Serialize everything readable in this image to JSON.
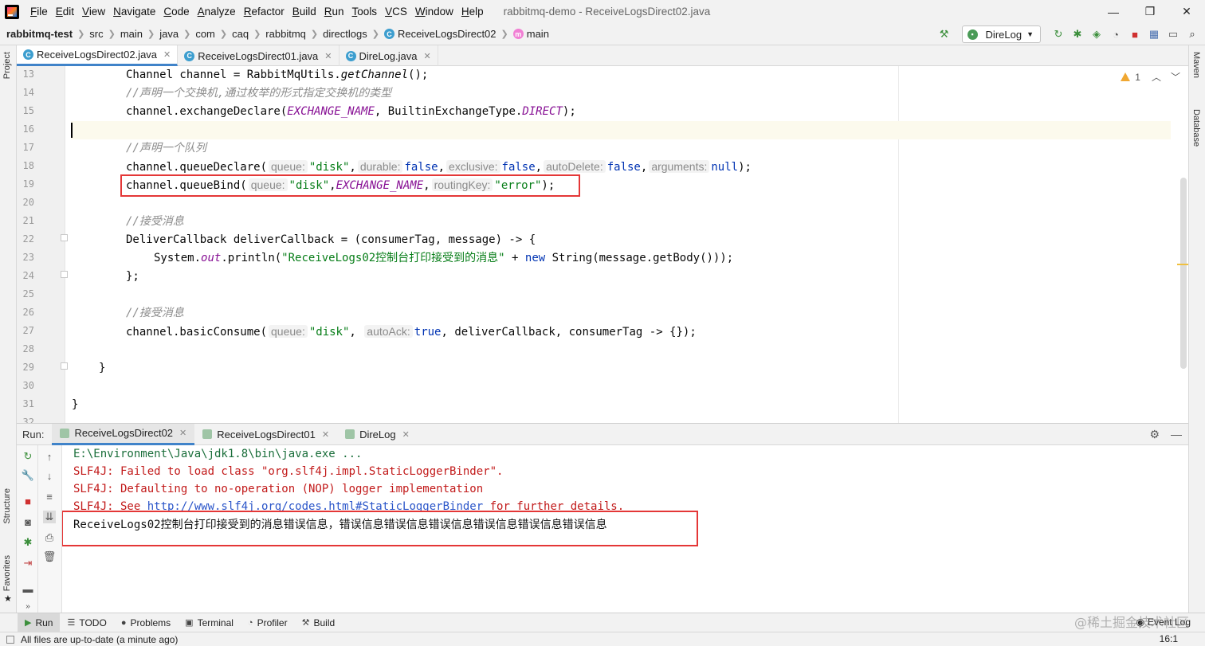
{
  "menubar": {
    "items": [
      "File",
      "Edit",
      "View",
      "Navigate",
      "Code",
      "Analyze",
      "Refactor",
      "Build",
      "Run",
      "Tools",
      "VCS",
      "Window",
      "Help"
    ],
    "window_title": "rabbitmq-demo - ReceiveLogsDirect02.java",
    "controls": [
      "minimize-icon",
      "restore-icon",
      "close-icon"
    ]
  },
  "breadcrumb": {
    "items": [
      "rabbitmq-test",
      "src",
      "main",
      "java",
      "com",
      "caq",
      "rabbitmq",
      "directlogs",
      "ReceiveLogsDirect02",
      "main"
    ],
    "run_config": "DireLog"
  },
  "left_strip": {
    "labels": [
      "Project",
      "Structure",
      "Favorites"
    ]
  },
  "right_strip": {
    "labels": [
      "Maven",
      "Database"
    ]
  },
  "editor_tabs": [
    {
      "label": "ReceiveLogsDirect02.java",
      "active": true
    },
    {
      "label": "ReceiveLogsDirect01.java",
      "active": false
    },
    {
      "label": "DireLog.java",
      "active": false
    }
  ],
  "editor": {
    "line_numbers": [
      "13",
      "14",
      "15",
      "16",
      "17",
      "18",
      "19",
      "20",
      "21",
      "22",
      "23",
      "24",
      "25",
      "26",
      "27",
      "28",
      "29",
      "30",
      "31",
      "32"
    ],
    "inspection_count": "1",
    "code": {
      "l13": {
        "a": "Channel channel = RabbitMqUtils.",
        "b": "getChannel",
        "c": "();"
      },
      "l14": "//声明一个交换机,通过枚举的形式指定交换机的类型",
      "l15": {
        "a": "channel.exchangeDeclare(",
        "b": "EXCHANGE_NAME",
        "c": ", BuiltinExchangeType.",
        "d": "DIRECT",
        "e": ");"
      },
      "l17": "//声明一个队列",
      "l18": {
        "a": "channel.queueDeclare(",
        "h1": "queue:",
        "s1": "\"disk\"",
        "h2": "durable:",
        "k1": "false",
        "h3": "exclusive:",
        "k2": "false",
        "h4": "autoDelete:",
        "k3": "false",
        "h5": "arguments:",
        "k4": "null",
        "e": ");"
      },
      "l19": {
        "a": "channel.queueBind(",
        "h1": "queue:",
        "s1": "\"disk\"",
        "c1": "EXCHANGE_NAME",
        "h2": "routingKey:",
        "s2": "\"error\"",
        "e": ");"
      },
      "l21": "//接受消息",
      "l22": {
        "a": "DeliverCallback deliverCallback = (consumerTag, message) -> {"
      },
      "l23": {
        "a": "System.",
        "b": "out",
        "c": ".println(",
        "s": "\"ReceiveLogs02控制台打印接受到的消息\"",
        "d": " + ",
        "k": "new",
        "e": " String(message.getBody()));"
      },
      "l24": "};",
      "l26": "//接受消息",
      "l27": {
        "a": "channel.basicConsume(",
        "h1": "queue:",
        "s1": "\"disk\"",
        "h2": "autoAck:",
        "k1": "true",
        "e": ", deliverCallback, consumerTag -> {});"
      },
      "l29": "}",
      "l31": "}"
    }
  },
  "run_panel": {
    "label": "Run:",
    "tabs": [
      {
        "label": "ReceiveLogsDirect02",
        "active": true
      },
      {
        "label": "ReceiveLogsDirect01",
        "active": false
      },
      {
        "label": "DireLog",
        "active": false
      }
    ],
    "console": {
      "line1": "E:\\Environment\\Java\\jdk1.8\\bin\\java.exe ...",
      "line2": "SLF4J: Failed to load class \"org.slf4j.impl.StaticLoggerBinder\".",
      "line3": "SLF4J: Defaulting to no-operation (NOP) logger implementation",
      "line4a": "SLF4J: See ",
      "line4link": "http://www.slf4j.org/codes.html#StaticLoggerBinder",
      "line4b": " for further details.",
      "line5a": "ReceiveLogs02",
      "line5b": "控制台打印接受到的消息错误信息，错误信息错误信息错误信息错误信息错误信息错误信息"
    }
  },
  "bottom_tabs": [
    "Run",
    "TODO",
    "Problems",
    "Terminal",
    "Profiler",
    "Build"
  ],
  "event_log": "Event Log",
  "watermark": "@稀土掘金技术社区",
  "status": {
    "message": "All files are up-to-date (a minute ago)",
    "caret": "16:1"
  },
  "colors": {
    "keyword": "#0033b3",
    "string": "#067d17",
    "constant": "#871094",
    "comment": "#8c8c8c",
    "error_text": "#c21a1a",
    "highlight_box": "#e43737",
    "tab_underline": "#4083c9"
  }
}
